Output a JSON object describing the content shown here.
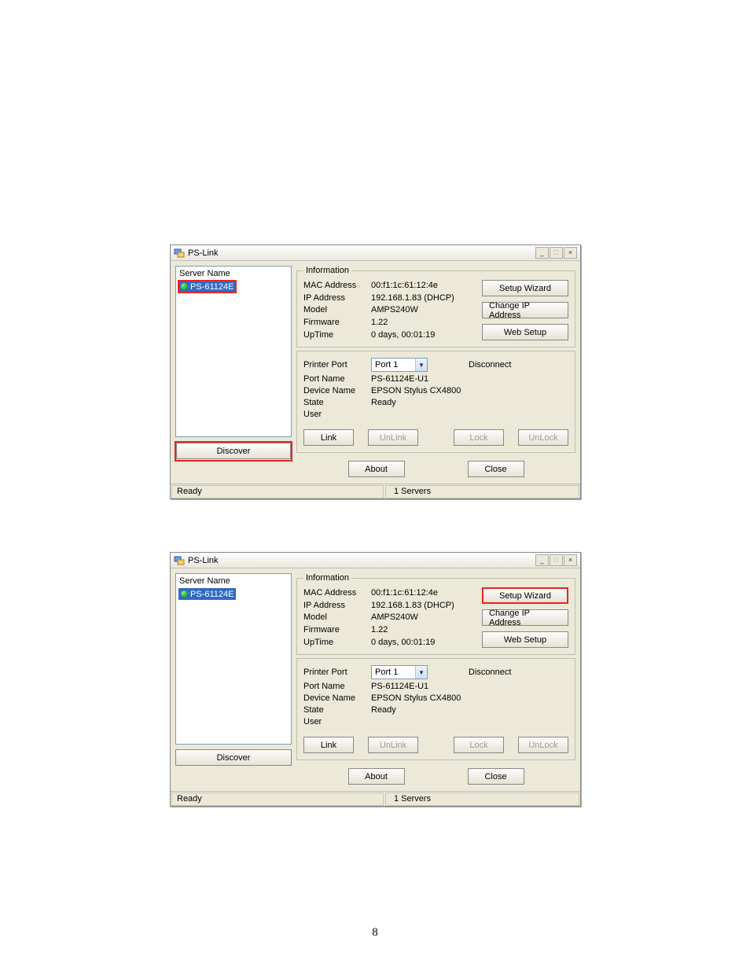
{
  "page_number": "8",
  "windows": [
    {
      "title": "PS-Link",
      "highlight": {
        "server_item": true,
        "discover": true,
        "setup_wizard": false
      },
      "server_list": {
        "header": "Server Name",
        "item": "PS-61124E"
      },
      "discover_label": "Discover",
      "info": {
        "legend": "Information",
        "rows": {
          "mac_label": "MAC Address",
          "mac_value": "00:f1:1c:61:12:4e",
          "ip_label": "IP Address",
          "ip_value": "192.168.1.83 (DHCP)",
          "model_label": "Model",
          "model_value": "AMPS240W",
          "fw_label": "Firmware",
          "fw_value": "1.22",
          "uptime_label": "UpTime",
          "uptime_value": "0 days, 00:01:19"
        },
        "side_buttons": {
          "setup": "Setup Wizard",
          "change_ip": "Change IP Address",
          "web": "Web Setup"
        }
      },
      "port": {
        "printer_port_label": "Printer Port",
        "printer_port_value": "Port 1",
        "status": "Disconnect",
        "port_name_label": "Port Name",
        "port_name_value": "PS-61124E-U1",
        "device_label": "Device Name",
        "device_value": "EPSON Stylus CX4800",
        "state_label": "State",
        "state_value": "Ready",
        "user_label": "User",
        "user_value": "",
        "buttons": {
          "link": "Link",
          "unlink": "UnLink",
          "lock": "Lock",
          "unlock": "UnLock"
        }
      },
      "bottom": {
        "about": "About",
        "close": "Close"
      },
      "status": {
        "ready": "Ready",
        "servers": "1 Servers"
      }
    },
    {
      "title": "PS-Link",
      "highlight": {
        "server_item": false,
        "discover": false,
        "setup_wizard": true
      },
      "server_list": {
        "header": "Server Name",
        "item": "PS-61124E"
      },
      "discover_label": "Discover",
      "info": {
        "legend": "Information",
        "rows": {
          "mac_label": "MAC Address",
          "mac_value": "00:f1:1c:61:12:4e",
          "ip_label": "IP Address",
          "ip_value": "192.168.1.83 (DHCP)",
          "model_label": "Model",
          "model_value": "AMPS240W",
          "fw_label": "Firmware",
          "fw_value": "1.22",
          "uptime_label": "UpTime",
          "uptime_value": "0 days, 00:01:19"
        },
        "side_buttons": {
          "setup": "Setup Wizard",
          "change_ip": "Change IP Address",
          "web": "Web Setup"
        }
      },
      "port": {
        "printer_port_label": "Printer Port",
        "printer_port_value": "Port 1",
        "status": "Disconnect",
        "port_name_label": "Port Name",
        "port_name_value": "PS-61124E-U1",
        "device_label": "Device Name",
        "device_value": "EPSON Stylus CX4800",
        "state_label": "State",
        "state_value": "Ready",
        "user_label": "User",
        "user_value": "",
        "buttons": {
          "link": "Link",
          "unlink": "UnLink",
          "lock": "Lock",
          "unlock": "UnLock"
        }
      },
      "bottom": {
        "about": "About",
        "close": "Close"
      },
      "status": {
        "ready": "Ready",
        "servers": "1 Servers"
      }
    }
  ]
}
